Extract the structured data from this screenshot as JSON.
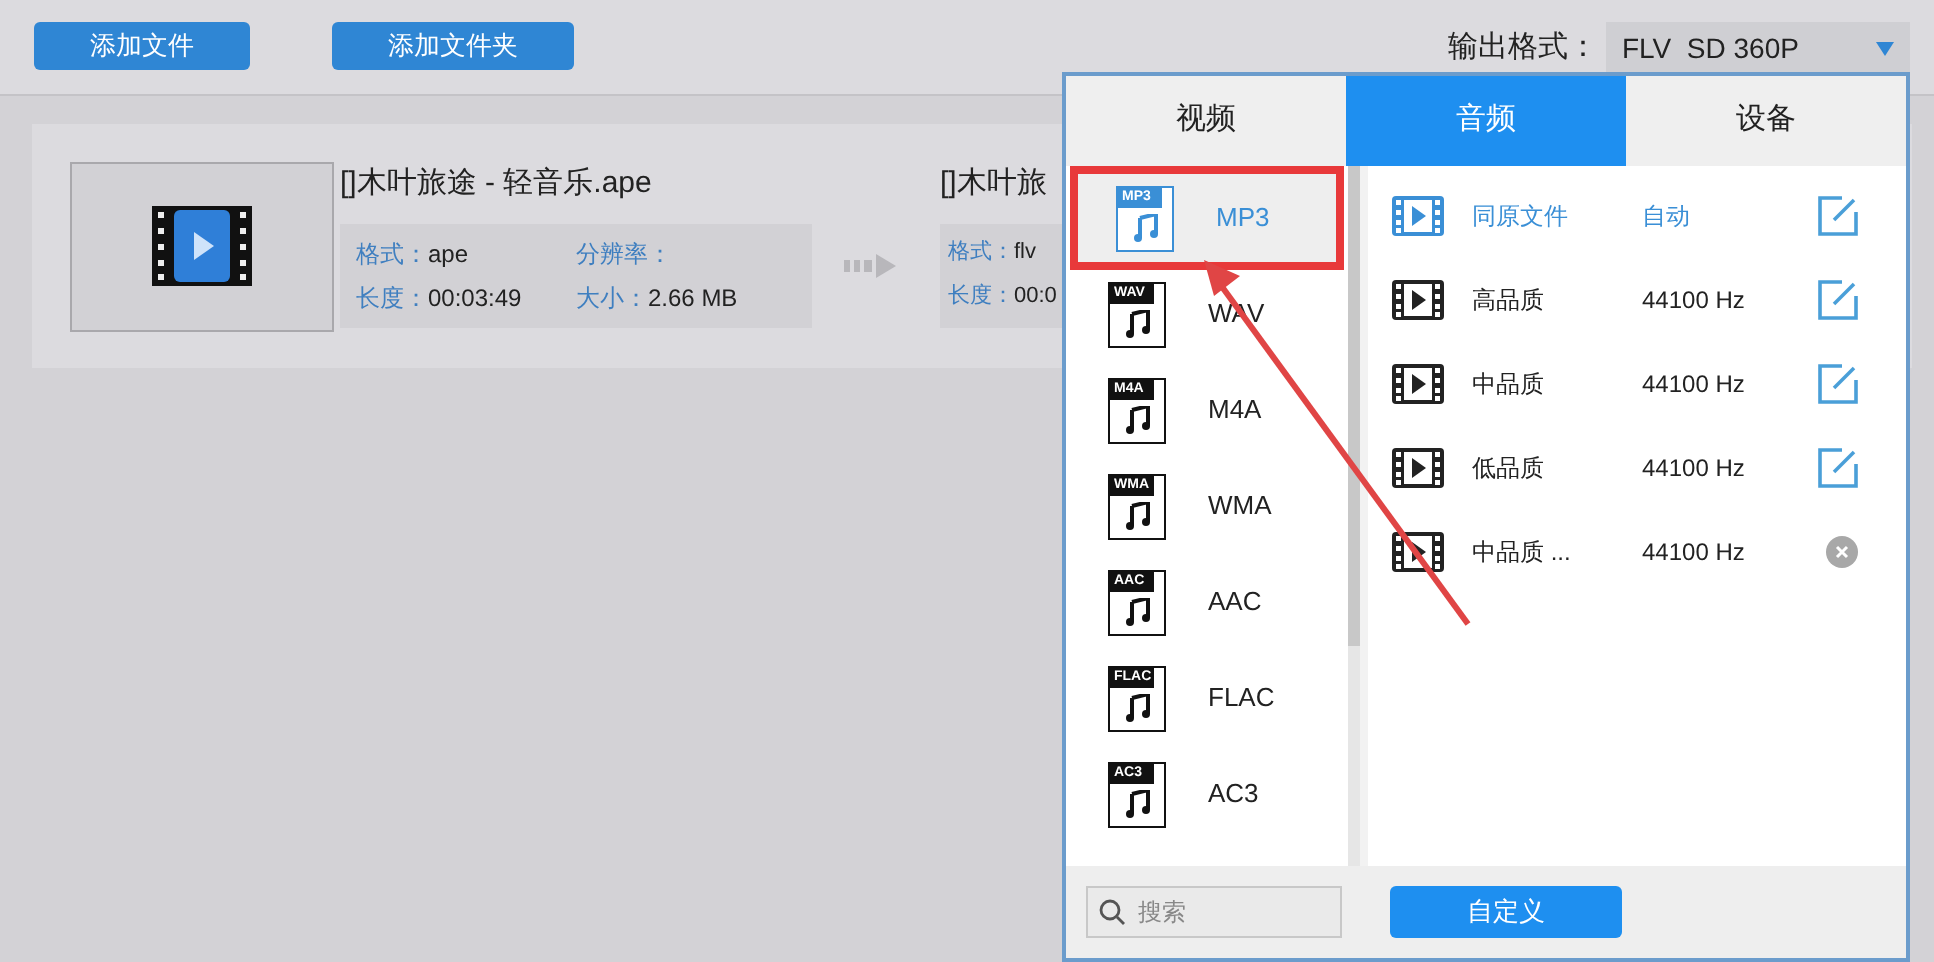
{
  "toolbar": {
    "buttons": [
      "添加文件",
      "添加文件夹"
    ],
    "output_format": {
      "label": "输出格式：",
      "value": "FLV  SD 360P"
    }
  },
  "task": {
    "source": {
      "name": "[]木叶旅途 - 轻音乐.ape",
      "fields": [
        {
          "label": "格式：",
          "value": "ape"
        },
        {
          "label": "分辨率："
        },
        {
          "label": "长度：",
          "value": "00:03:49"
        },
        {
          "label": "大小：",
          "value": "2.66 MB"
        }
      ]
    },
    "target": {
      "name": "[]木叶旅",
      "fields": [
        {
          "label": "格式：",
          "value": "flv"
        },
        {
          "label": "长度：",
          "value": "00:0"
        }
      ]
    }
  },
  "format_popup": {
    "tabs": [
      {
        "label": "视频",
        "selected": false
      },
      {
        "label": "音频",
        "selected": true
      },
      {
        "label": "设备",
        "selected": false
      }
    ],
    "formats": [
      {
        "name": "MP3",
        "badge": "MP3",
        "selected": true
      },
      {
        "name": "WAV",
        "badge": "WAV",
        "selected": false
      },
      {
        "name": "M4A",
        "badge": "M4A",
        "selected": false
      },
      {
        "name": "WMA",
        "badge": "WMA",
        "selected": false
      },
      {
        "name": "AAC",
        "badge": "AAC",
        "selected": false
      },
      {
        "name": "FLAC",
        "badge": "FLAC",
        "selected": false
      },
      {
        "name": "AC3",
        "badge": "AC3",
        "selected": false
      }
    ],
    "presets": [
      {
        "name": "同原文件",
        "rate": "自动",
        "kind": "original",
        "editable": true
      },
      {
        "name": "高品质",
        "rate": "44100 Hz",
        "kind": "preset",
        "editable": true
      },
      {
        "name": "中品质",
        "rate": "44100 Hz",
        "kind": "preset",
        "editable": true
      },
      {
        "name": "低品质",
        "rate": "44100 Hz",
        "kind": "preset",
        "editable": true
      },
      {
        "name": "中品质 ...",
        "rate": "44100 Hz",
        "kind": "preset",
        "editable": false
      }
    ],
    "search": {
      "placeholder": "搜索"
    },
    "custom_button": "自定义"
  }
}
